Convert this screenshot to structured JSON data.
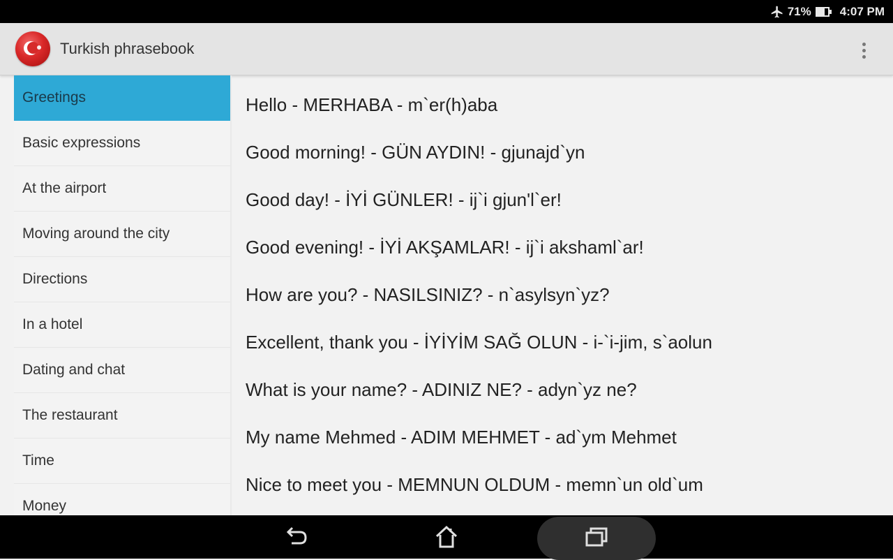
{
  "status_bar": {
    "airplane_icon": "airplane-icon",
    "battery_percent": "71%",
    "battery_level": 0.71,
    "battery_icon": "battery-icon",
    "time": "4:07 PM"
  },
  "action_bar": {
    "app_icon": "turkey-flag-icon",
    "title": "Turkish phrasebook",
    "overflow_icon": "overflow-menu-icon"
  },
  "sidebar": {
    "selected_index": 0,
    "items": [
      {
        "label": "Greetings"
      },
      {
        "label": "Basic expressions"
      },
      {
        "label": "At the airport"
      },
      {
        "label": "Moving around the city"
      },
      {
        "label": "Directions"
      },
      {
        "label": "In a hotel"
      },
      {
        "label": "Dating and chat"
      },
      {
        "label": "The restaurant"
      },
      {
        "label": "Time"
      },
      {
        "label": "Money"
      }
    ]
  },
  "content": {
    "phrases": [
      {
        "text": "Hello - MERHABA - m`er(h)aba"
      },
      {
        "text": "Good morning! - GÜN AYDIN! - gjunajd`yn"
      },
      {
        "text": "Good day! - İYİ GÜNLER! - ij`i gjun'l`er!"
      },
      {
        "text": "Good evening! - İYİ AKŞAMLAR! - ij`i akshaml`ar!"
      },
      {
        "text": "How are you? - NASILSINIZ? - n`asylsyn`yz?"
      },
      {
        "text": "Excellent, thank you - İYİYİM SAĞ OLUN - i-`i-jim, s`aolun"
      },
      {
        "text": "What is your name? - ADINIZ NE? - adyn`yz ne?"
      },
      {
        "text": "My name Mehmed - ADIM MEHMET - ad`ym Mehmet"
      },
      {
        "text": "Nice to meet you - MEMNUN OLDUM - memn`un old`um"
      }
    ]
  },
  "nav_bar": {
    "back_icon": "back-icon",
    "home_icon": "home-icon",
    "recents_icon": "recent-apps-icon"
  },
  "colors": {
    "accent": "#2ea9d6",
    "action_bar_bg": "#e4e4e4",
    "background": "#f2f2f2",
    "system_bar_bg": "#000000"
  }
}
